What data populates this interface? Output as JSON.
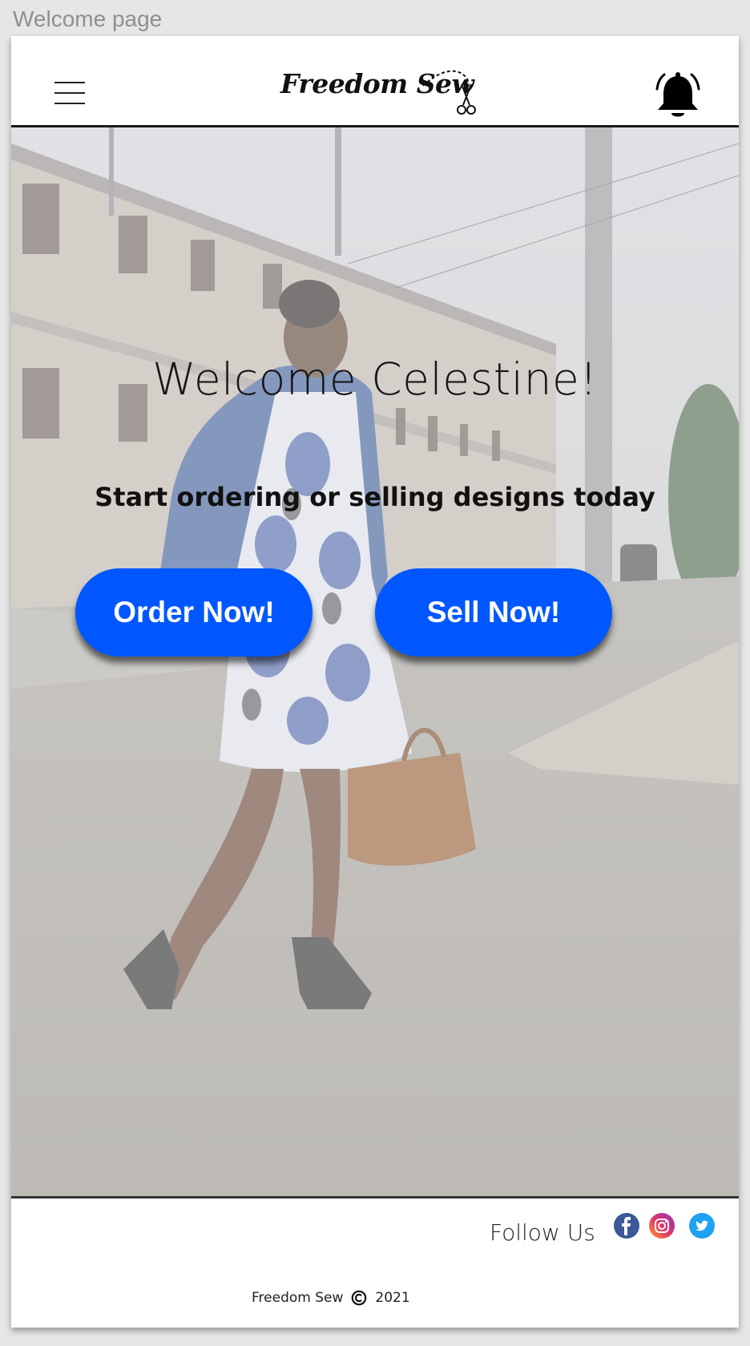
{
  "frame": {
    "label": "Welcome page"
  },
  "header": {
    "logo_text": "Freedom Sew",
    "menu_icon": "hamburger-menu-icon",
    "notification_icon": "bell-icon"
  },
  "hero": {
    "greeting": "Welcome Celestine!",
    "subtitle": "Start ordering or selling designs today",
    "order_button_label": "Order Now!",
    "sell_button_label": "Sell Now!",
    "background_image": "woman-in-patterned-dress-street-photo"
  },
  "footer": {
    "follow_label": "Follow Us",
    "social_icons": [
      "facebook-icon",
      "instagram-icon",
      "twitter-icon"
    ],
    "brand": "Freedom Sew",
    "copyright_symbol": "©",
    "year": "2021"
  },
  "colors": {
    "primary_button": "#0057ff",
    "facebook": "#3b5998",
    "twitter": "#1da1f2",
    "header_border": "#1a1a1a"
  }
}
